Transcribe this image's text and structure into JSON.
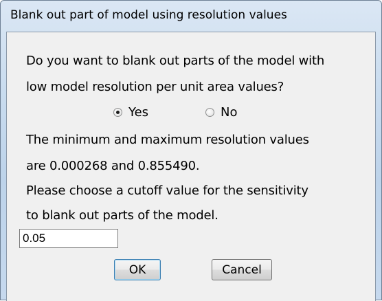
{
  "window": {
    "title": "Blank out part of model using resolution values"
  },
  "dialog": {
    "question_line1": "Do you want to blank out parts of the model with",
    "question_line2": "low model resolution per unit area values?",
    "radio_options": [
      {
        "label": "Yes",
        "checked": true
      },
      {
        "label": "No",
        "checked": false
      }
    ],
    "info_line1": "The minimum and maximum resolution values",
    "info_line2": "are 0.000268 and 0.855490.",
    "prompt_line1": "Please choose a cutoff value for the sensitivity",
    "prompt_line2": "to blank out parts of the model.",
    "cutoff_value": "0.05",
    "ok_label": "OK",
    "cancel_label": "Cancel"
  }
}
